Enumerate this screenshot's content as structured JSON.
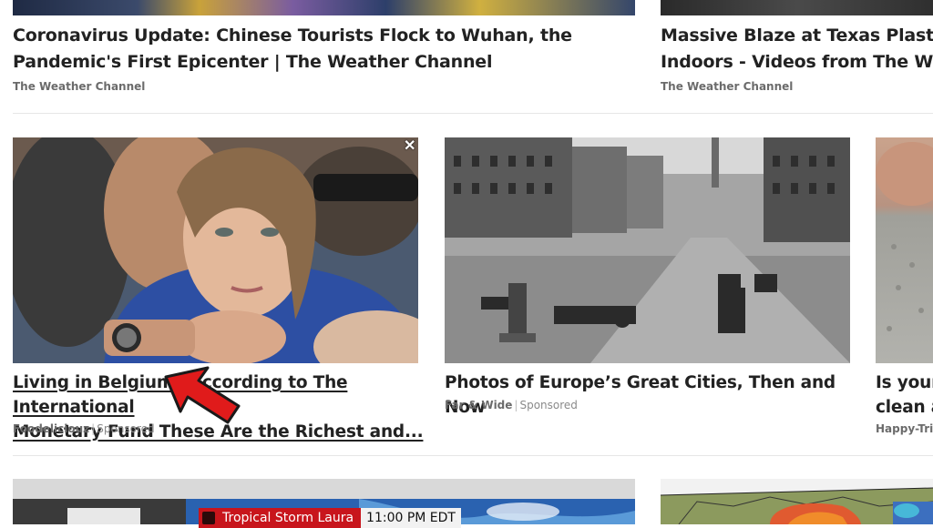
{
  "row1": [
    {
      "headline_lines": [
        "Coronavirus Update: Chinese Tourists Flock to Wuhan, the",
        "Pandemic's First Epicenter | The Weather Channel"
      ],
      "source": "The Weather Channel"
    },
    {
      "headline_lines": [
        "Massive Blaze at Texas Plastics",
        "Indoors - Videos from The We"
      ],
      "source": "The Weather Channel"
    }
  ],
  "row2": [
    {
      "headline_lines": [
        "Living in Belgium? According to The International",
        "Monetary Fund These Are the Richest and..."
      ],
      "source": "Foodeliciouz",
      "sponsored": "Sponsored",
      "close": "✕",
      "arrow_icon": "red-pointer-arrow-icon"
    },
    {
      "headline_lines": [
        "Photos of Europe’s Great Cities, Then and Now"
      ],
      "source": "Far & Wide",
      "sponsored": "Sponsored"
    },
    {
      "headline_lines": [
        "Is your",
        "clean a"
      ],
      "source": "Happy-Tri"
    }
  ],
  "row3": {
    "ticker_label": "Tropical Storm Laura",
    "ticker_time": "11:00 PM EDT"
  },
  "colors": {
    "ticker_red": "#c8151c",
    "arrow_red": "#e01b1b"
  }
}
